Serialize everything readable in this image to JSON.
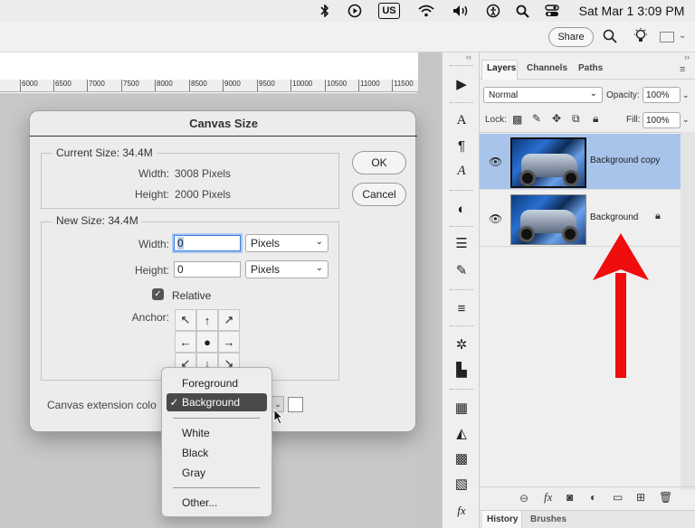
{
  "menubar": {
    "input_source": "US",
    "clock": "Sat Mar 1  3:09 PM",
    "icons": [
      "bluetooth-icon",
      "play-circle-icon",
      "keyboard-icon",
      "wifi-icon",
      "volume-icon",
      "accessibility-icon",
      "search-icon",
      "control-center-icon"
    ]
  },
  "apptoolbar": {
    "share_label": "Share"
  },
  "ruler": {
    "ticks": [
      "6000",
      "6500",
      "7000",
      "7500",
      "8000",
      "8500",
      "9000",
      "9500",
      "10000",
      "10500",
      "11000",
      "11500"
    ]
  },
  "dialog": {
    "title": "Canvas Size",
    "current_size_label": "Current Size: 34.4M",
    "width_label": "Width:",
    "width_value": "3008 Pixels",
    "height_label": "Height:",
    "height_value": "2000 Pixels",
    "new_size_label": "New Size: 34.4M",
    "new_width_label": "Width:",
    "new_width_value": "0",
    "new_height_label": "Height:",
    "new_height_value": "0",
    "unit_width": "Pixels",
    "unit_height": "Pixels",
    "relative_label": "Relative",
    "relative_checked": true,
    "anchor_label": "Anchor:",
    "extension_label": "Canvas extension colo",
    "ok_label": "OK",
    "cancel_label": "Cancel"
  },
  "popup": {
    "items": [
      "Foreground",
      "Background",
      "White",
      "Black",
      "Gray",
      "Other..."
    ],
    "selected": "Background",
    "check": "✓"
  },
  "layers_panel": {
    "tabs": [
      "Layers",
      "Channels",
      "Paths"
    ],
    "blend_mode": "Normal",
    "opacity_label": "Opacity:",
    "opacity_value": "100%",
    "lock_label": "Lock:",
    "fill_label": "Fill:",
    "fill_value": "100%",
    "layers": [
      {
        "name": "Background copy",
        "selected": true,
        "locked": false
      },
      {
        "name": "Background",
        "selected": false,
        "locked": true
      }
    ],
    "bottom_tabs": [
      "History",
      "Brushes"
    ]
  },
  "colors": {
    "annotation_arrow": "#f00d0d",
    "selected_layer": "#a9c4ea",
    "focus_ring": "#3b7cd6"
  }
}
